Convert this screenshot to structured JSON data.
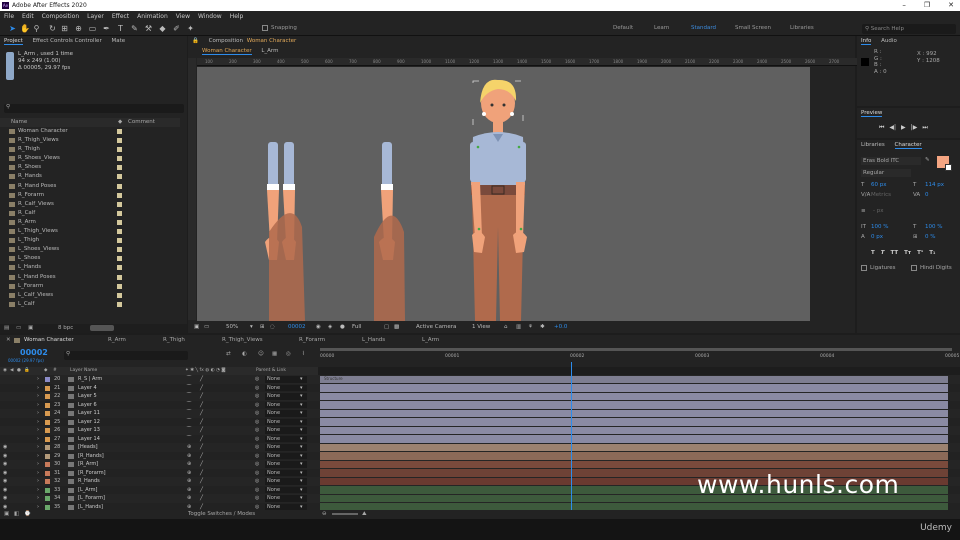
{
  "window": {
    "title": "Adobe After Effects 2020",
    "logo": "Ae",
    "controls": [
      "–",
      "❐",
      "✕"
    ]
  },
  "menu": [
    "File",
    "Edit",
    "Composition",
    "Layer",
    "Effect",
    "Animation",
    "View",
    "Window",
    "Help"
  ],
  "toolbar": {
    "snapping": "Snapping",
    "workspaces": [
      "Default",
      "Learn",
      "Standard",
      "Small Screen",
      "Libraries"
    ],
    "active_workspace": "Standard",
    "search_placeholder": "Search Help"
  },
  "project": {
    "tabs": [
      "Project",
      "Effect Controls Controller",
      "Mate"
    ],
    "selected_name": "L_Arm , used 1 time",
    "selected_dims": "94 x 249 (1.00)",
    "selected_fps": "Δ 00005, 29.97 fps",
    "col_name": "Name",
    "col_comment": "Comment",
    "items": [
      "Woman Character",
      "R_Thigh_Views",
      "R_Thigh",
      "R_Shoes_Views",
      "R_Shoes",
      "R_Hands",
      "R_Hand Poses",
      "R_Forarm",
      "R_Calf_Views",
      "R_Calf",
      "R_Arm",
      "L_Thigh_Views",
      "L_Thigh",
      "L_Shoes_Views",
      "L_Shoes",
      "L_Hands",
      "L_Hand Poses",
      "L_Forarm",
      "L_Calf_Views",
      "L_Calf"
    ],
    "bpc": "8 bpc"
  },
  "composition": {
    "panel_label": "Composition",
    "name": "Woman Character",
    "tabs": [
      "Woman Character",
      "L_Arm"
    ],
    "ruler_ticks": [
      "100",
      "200",
      "300",
      "400",
      "500",
      "600",
      "700",
      "800",
      "900",
      "1000",
      "1100",
      "1200",
      "1300",
      "1400",
      "1500",
      "1600",
      "1700",
      "1800",
      "1900",
      "2000",
      "2100",
      "2200",
      "2300",
      "2400",
      "2500",
      "2600",
      "2700"
    ],
    "zoom": "50%",
    "timecode": "00002",
    "resolution": "Full",
    "camera": "Active Camera",
    "view": "1 View",
    "exposure": "+0.0"
  },
  "info": {
    "tabs": [
      "Info",
      "Audio"
    ],
    "channels": [
      "R :",
      "G :",
      "B :",
      "A : 0"
    ],
    "x": "X : 992",
    "y": "Y : 1208"
  },
  "preview": {
    "title": "Preview",
    "buttons": [
      "⏮",
      "◀|",
      "▶",
      "|▶",
      "⏭"
    ]
  },
  "character": {
    "tabs": [
      "Libraries",
      "Character"
    ],
    "font": "Eras Bold ITC",
    "style": "Regular",
    "size": "60 px",
    "leading": "114 px",
    "tracking_label": "Metrics",
    "tracking": "0",
    "stroke": "- px",
    "v_scale": "100 %",
    "h_scale": "100 %",
    "baseline": "0 px",
    "tsume": "0 %",
    "format_buttons": [
      "T",
      "T",
      "TT",
      "Tт",
      "T¹",
      "T₁"
    ],
    "ligatures": "Ligatures",
    "hindi": "Hindi Digits",
    "fill_color": "#f4a582"
  },
  "timeline": {
    "tabs": [
      "Woman Character",
      "R_Arm",
      "R_Thigh",
      "R_Thigh_Views",
      "R_Forarm",
      "L_Hands",
      "L_Arm"
    ],
    "timecode": "00002",
    "subcode": "00002 (29.97 fps)",
    "col_layer_name": "Layer Name",
    "col_parent": "Parent & Link",
    "time_marks": [
      "00000",
      "00001",
      "00002",
      "00003",
      "00004",
      "00005"
    ],
    "footer": "Toggle Switches / Modes",
    "bar_label": "Structure",
    "layers": [
      {
        "num": "20",
        "name": "R_S | Arm",
        "color": "#8c8cc8",
        "parent": "None",
        "bar": "#7e7e91"
      },
      {
        "num": "21",
        "name": "Layer 4",
        "color": "#d89a50",
        "parent": "None",
        "bar": "#8a8aa3"
      },
      {
        "num": "22",
        "name": "Layer 5",
        "color": "#d89a50",
        "parent": "None",
        "bar": "#8a8aa3"
      },
      {
        "num": "23",
        "name": "Layer 6",
        "color": "#d89a50",
        "parent": "None",
        "bar": "#8a8aa3"
      },
      {
        "num": "24",
        "name": "Layer 11",
        "color": "#d89a50",
        "parent": "None",
        "bar": "#8a8aa3"
      },
      {
        "num": "25",
        "name": "Layer 12",
        "color": "#d89a50",
        "parent": "None",
        "bar": "#8a8aa3"
      },
      {
        "num": "26",
        "name": "Layer 13",
        "color": "#d89a50",
        "parent": "None",
        "bar": "#8a8aa3"
      },
      {
        "num": "27",
        "name": "Layer 14",
        "color": "#d89a50",
        "parent": "None",
        "bar": "#8a8aa3"
      },
      {
        "num": "28",
        "name": "[Heads]",
        "color": "#b39a7a",
        "parent": "None",
        "bar": "#9c8270"
      },
      {
        "num": "29",
        "name": "[R_Hands]",
        "color": "#b39a7a",
        "parent": "None",
        "bar": "#8c6a58"
      },
      {
        "num": "30",
        "name": "[R_Arm]",
        "color": "#c87a5a",
        "parent": "None",
        "bar": "#7a4a3c"
      },
      {
        "num": "31",
        "name": "[R_Forarm]",
        "color": "#c87a5a",
        "parent": "None",
        "bar": "#6e4236"
      },
      {
        "num": "32",
        "name": "R_Hands",
        "color": "#c87a5a",
        "parent": "None",
        "bar": "#6a3a30"
      },
      {
        "num": "33",
        "name": "[L_Arm]",
        "color": "#6aa86a",
        "parent": "None",
        "bar": "#3d5a3c"
      },
      {
        "num": "34",
        "name": "[L_Forarm]",
        "color": "#6aa86a",
        "parent": "None",
        "bar": "#3d5a3c"
      },
      {
        "num": "35",
        "name": "[L_Hands]",
        "color": "#6aa86a",
        "parent": "None",
        "bar": "#3d5a3c"
      }
    ]
  },
  "watermark": "www.hunls.com",
  "brand": "Udemy"
}
